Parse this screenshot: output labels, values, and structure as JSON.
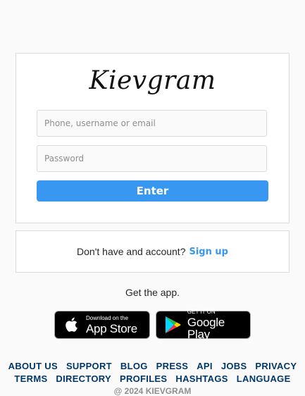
{
  "brand": {
    "logo_text": "Kievgram"
  },
  "login": {
    "identifier_placeholder": "Phone, username or email",
    "password_placeholder": "Password",
    "enter_label": "Enter"
  },
  "signup": {
    "prompt": "Don't have and account?",
    "link": "Sign up"
  },
  "app": {
    "get_the_app": "Get the app.",
    "apple_small": "Download on the",
    "apple_big": "App Store",
    "google_small": "GET IT ON",
    "google_big": "Google Play"
  },
  "footer": {
    "row1": [
      "ABOUT US",
      "SUPPORT",
      "BLOG",
      "PRESS",
      "API",
      "JOBS",
      "PRIVACY"
    ],
    "row2": [
      "TERMS",
      "DIRECTORY",
      "PROFILES",
      "HASHTAGS",
      "LANGUAGE"
    ],
    "copyright": "@ 2024 KIEVGRAM"
  },
  "colors": {
    "accent": "#3897f0",
    "border": "#dbdbdb",
    "background": "#fafafa"
  }
}
